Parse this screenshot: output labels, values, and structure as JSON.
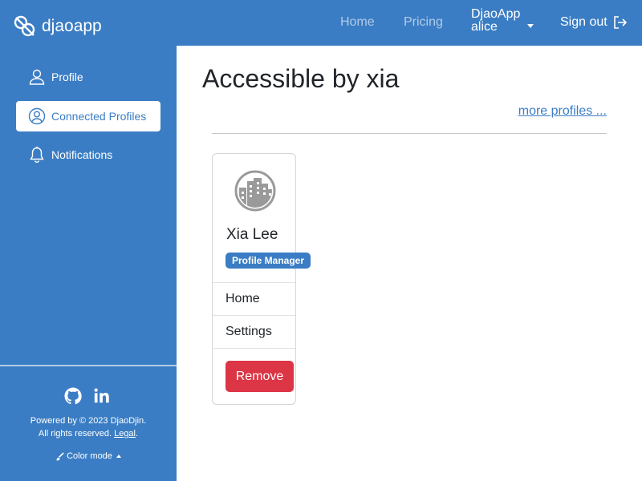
{
  "colors": {
    "brand": "#3b7dc4",
    "danger": "#dc3545"
  },
  "navbar": {
    "brand": "djaoapp",
    "links": {
      "home": "Home",
      "pricing": "Pricing"
    },
    "account": {
      "org": "DjaoApp",
      "user": "alice"
    },
    "signout": "Sign out"
  },
  "sidebar": {
    "items": [
      {
        "label": "Profile",
        "icon": "person-icon"
      },
      {
        "label": "Connected Profiles",
        "icon": "person-circle-icon",
        "active": true
      },
      {
        "label": "Notifications",
        "icon": "bell-icon"
      }
    ],
    "footer": {
      "powered": "Powered by © 2023 DjaoDjin.",
      "rights": "All rights reserved.",
      "legal": "Legal",
      "legal_suffix": ".",
      "color_mode": "Color mode"
    }
  },
  "main": {
    "title": "Accessible by xia",
    "more_link": "more profiles ...",
    "card": {
      "name": "Xia Lee",
      "role": "Profile Manager",
      "links": {
        "home": "Home",
        "settings": "Settings"
      },
      "remove": "Remove"
    }
  }
}
